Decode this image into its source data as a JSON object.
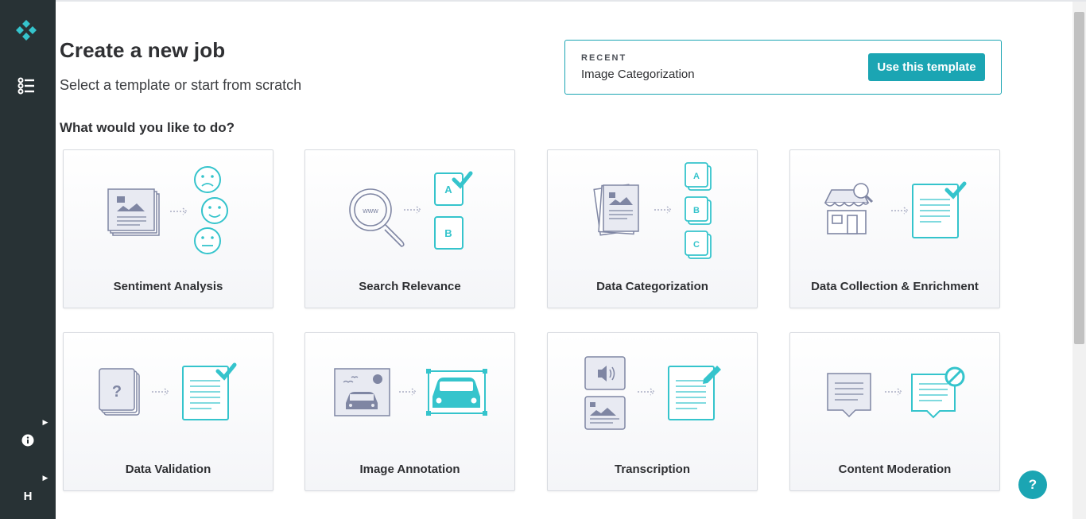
{
  "sidebar": {
    "logo_icon": "diamond-logo-icon",
    "jobs_icon": "list-icon",
    "info_icon": "info-icon",
    "user_initial": "H"
  },
  "header": {
    "title": "Create a new job",
    "subtitle": "Select a template or start from scratch"
  },
  "recent": {
    "label": "RECENT",
    "name": "Image Categorization",
    "button_label": "Use this template"
  },
  "question": "What would you like to do?",
  "templates": [
    {
      "label": "Sentiment Analysis",
      "icon": "sentiment-analysis-illustration"
    },
    {
      "label": "Search Relevance",
      "icon": "search-relevance-illustration"
    },
    {
      "label": "Data Categorization",
      "icon": "data-categorization-illustration"
    },
    {
      "label": "Data Collection & Enrichment",
      "icon": "data-collection-illustration"
    },
    {
      "label": "Data Validation",
      "icon": "data-validation-illustration"
    },
    {
      "label": "Image Annotation",
      "icon": "image-annotation-illustration"
    },
    {
      "label": "Transcription",
      "icon": "transcription-illustration"
    },
    {
      "label": "Content Moderation",
      "icon": "content-moderation-illustration"
    }
  ],
  "help_button_label": "?",
  "colors": {
    "sidebar": "#283235",
    "accent": "#1ba5b3",
    "illustration_teal": "#35c4cc",
    "illustration_slate": "#7f86a3"
  }
}
